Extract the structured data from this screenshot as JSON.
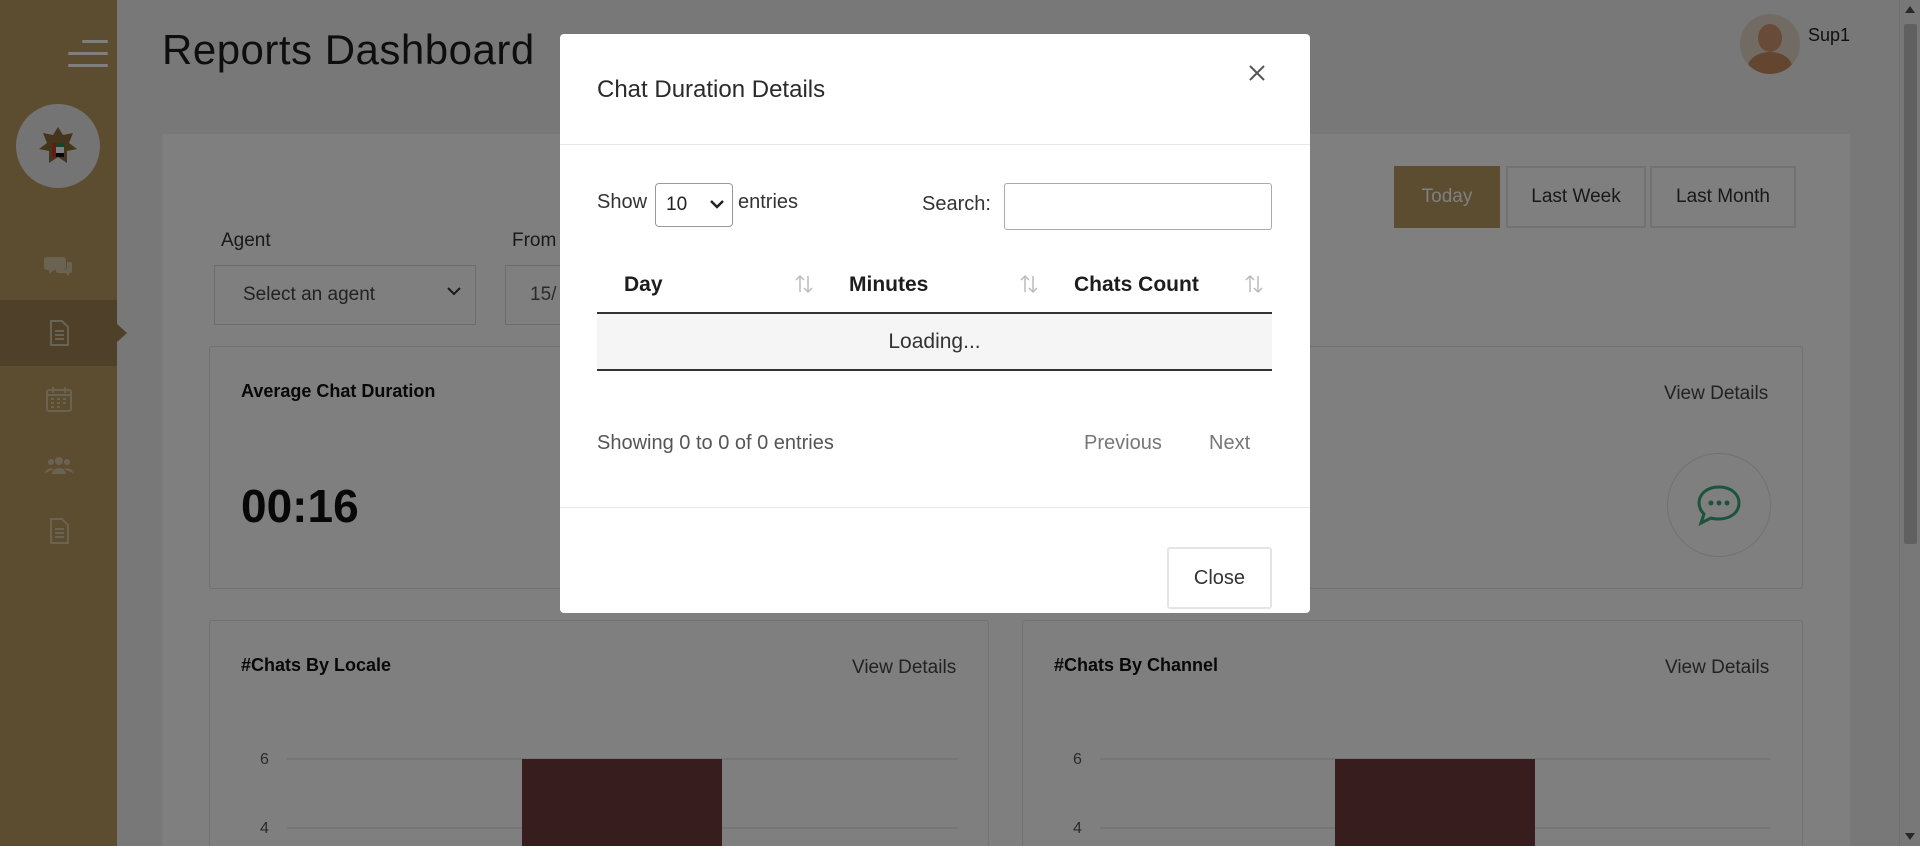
{
  "page": {
    "title": "Reports Dashboard"
  },
  "user": {
    "name": "Sup1"
  },
  "sidebar": {
    "icons": [
      "menu-icon",
      "emblem-logo",
      "chat-icon",
      "report-icon",
      "calendar-icon",
      "users-icon",
      "document-icon"
    ]
  },
  "filters": {
    "agent_label": "Agent",
    "agent_placeholder": "Select an agent",
    "from_label": "From",
    "from_value": "15/",
    "ranges": [
      "Today",
      "Last Week",
      "Last Month"
    ]
  },
  "cards": {
    "avg_duration": {
      "title": "Average Chat Duration",
      "value": "00:16"
    },
    "top_right": {
      "view_details": "View Details"
    },
    "locale": {
      "title": "#Chats By Locale",
      "view_details": "View Details"
    },
    "channel": {
      "title": "#Chats By Channel",
      "view_details": "View Details"
    }
  },
  "chart_data": [
    {
      "type": "bar",
      "ticks": [
        "6",
        "4"
      ],
      "bar_color": "#6f3a3a",
      "note": ""
    },
    {
      "type": "bar",
      "ticks": [
        "6",
        "4"
      ],
      "bar_color": "#6f3a3a"
    }
  ],
  "modal": {
    "title": "Chat Duration Details",
    "show_label": "Show",
    "entries_value": "10",
    "entries_label": "entries",
    "search_label": "Search:",
    "columns": [
      "Day",
      "Minutes",
      "Chats Count"
    ],
    "loading_text": "Loading...",
    "info_text": "Showing 0 to 0 of 0 entries",
    "previous_label": "Previous",
    "next_label": "Next",
    "close_label": "Close"
  },
  "colors": {
    "brand": "#b99a62",
    "accent_green": "#3aa57a",
    "bar": "#6f3a3a"
  }
}
